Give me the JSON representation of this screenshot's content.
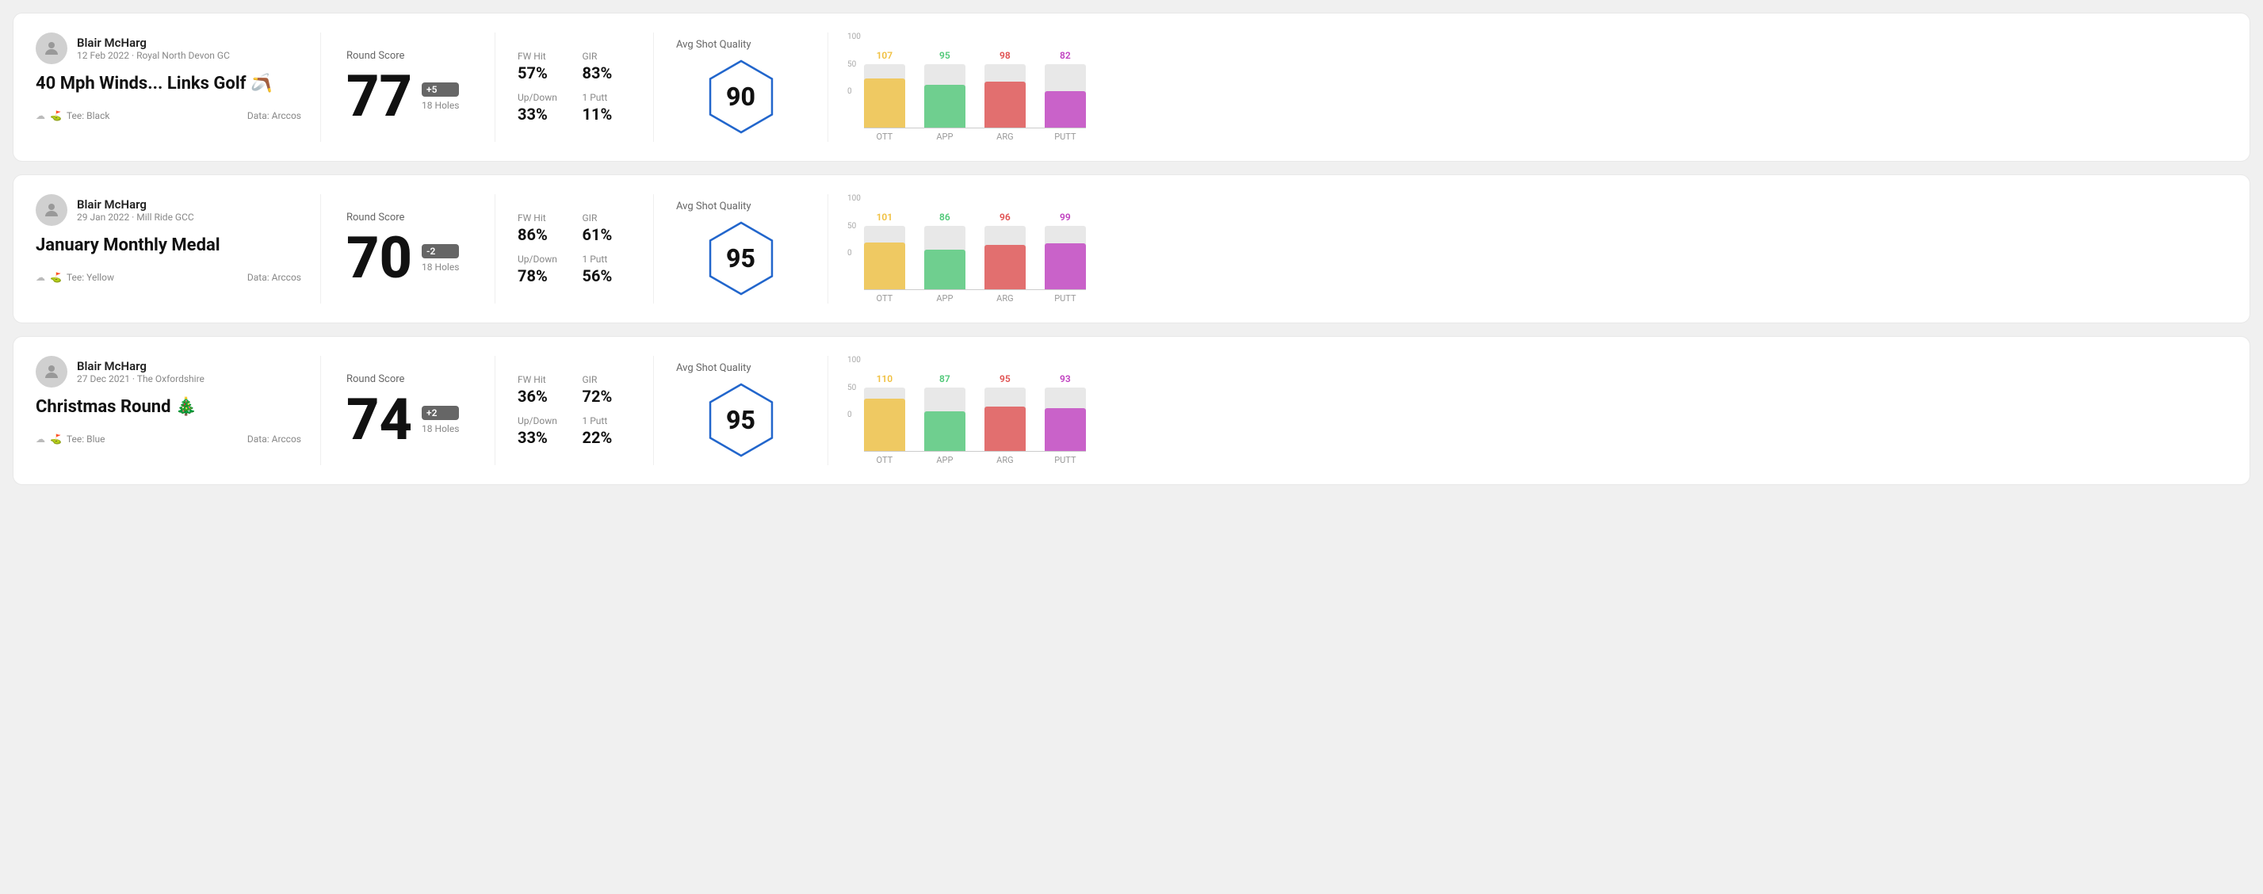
{
  "rounds": [
    {
      "id": "round-1",
      "user": {
        "name": "Blair McHarg",
        "meta": "12 Feb 2022 · Royal North Devon GC"
      },
      "title": "40 Mph Winds... Links Golf 🪃",
      "tee": "Black",
      "dataSource": "Data: Arccos",
      "roundScore": {
        "label": "Round Score",
        "score": "77",
        "badge": "+5",
        "badgeType": "positive",
        "holes": "18 Holes"
      },
      "stats": {
        "fwHit": {
          "label": "FW Hit",
          "value": "57%"
        },
        "gir": {
          "label": "GIR",
          "value": "83%"
        },
        "upDown": {
          "label": "Up/Down",
          "value": "33%"
        },
        "onePutt": {
          "label": "1 Putt",
          "value": "11%"
        }
      },
      "avgShotQuality": {
        "label": "Avg Shot Quality",
        "score": "90"
      },
      "chart": {
        "columns": [
          {
            "label": "OTT",
            "value": 107,
            "color": "#f0c040",
            "heightPct": 78
          },
          {
            "label": "APP",
            "value": 95,
            "color": "#50c878",
            "heightPct": 68
          },
          {
            "label": "ARG",
            "value": 98,
            "color": "#e05050",
            "heightPct": 72
          },
          {
            "label": "PUTT",
            "value": 82,
            "color": "#c040c0",
            "heightPct": 58
          }
        ],
        "yLabels": [
          "100",
          "50",
          "0"
        ]
      }
    },
    {
      "id": "round-2",
      "user": {
        "name": "Blair McHarg",
        "meta": "29 Jan 2022 · Mill Ride GCC"
      },
      "title": "January Monthly Medal",
      "tee": "Yellow",
      "dataSource": "Data: Arccos",
      "roundScore": {
        "label": "Round Score",
        "score": "70",
        "badge": "-2",
        "badgeType": "negative",
        "holes": "18 Holes"
      },
      "stats": {
        "fwHit": {
          "label": "FW Hit",
          "value": "86%"
        },
        "gir": {
          "label": "GIR",
          "value": "61%"
        },
        "upDown": {
          "label": "Up/Down",
          "value": "78%"
        },
        "onePutt": {
          "label": "1 Putt",
          "value": "56%"
        }
      },
      "avgShotQuality": {
        "label": "Avg Shot Quality",
        "score": "95"
      },
      "chart": {
        "columns": [
          {
            "label": "OTT",
            "value": 101,
            "color": "#f0c040",
            "heightPct": 74
          },
          {
            "label": "APP",
            "value": 86,
            "color": "#50c878",
            "heightPct": 62
          },
          {
            "label": "ARG",
            "value": 96,
            "color": "#e05050",
            "heightPct": 70
          },
          {
            "label": "PUTT",
            "value": 99,
            "color": "#c040c0",
            "heightPct": 73
          }
        ],
        "yLabels": [
          "100",
          "50",
          "0"
        ]
      }
    },
    {
      "id": "round-3",
      "user": {
        "name": "Blair McHarg",
        "meta": "27 Dec 2021 · The Oxfordshire"
      },
      "title": "Christmas Round 🎄",
      "tee": "Blue",
      "dataSource": "Data: Arccos",
      "roundScore": {
        "label": "Round Score",
        "score": "74",
        "badge": "+2",
        "badgeType": "positive",
        "holes": "18 Holes"
      },
      "stats": {
        "fwHit": {
          "label": "FW Hit",
          "value": "36%"
        },
        "gir": {
          "label": "GIR",
          "value": "72%"
        },
        "upDown": {
          "label": "Up/Down",
          "value": "33%"
        },
        "onePutt": {
          "label": "1 Putt",
          "value": "22%"
        }
      },
      "avgShotQuality": {
        "label": "Avg Shot Quality",
        "score": "95"
      },
      "chart": {
        "columns": [
          {
            "label": "OTT",
            "value": 110,
            "color": "#f0c040",
            "heightPct": 82
          },
          {
            "label": "APP",
            "value": 87,
            "color": "#50c878",
            "heightPct": 63
          },
          {
            "label": "ARG",
            "value": 95,
            "color": "#e05050",
            "heightPct": 70
          },
          {
            "label": "PUTT",
            "value": 93,
            "color": "#c040c0",
            "heightPct": 68
          }
        ],
        "yLabels": [
          "100",
          "50",
          "0"
        ]
      }
    }
  ],
  "labels": {
    "teePrefix": "Tee:",
    "weather": "☁",
    "teeIcon": "⛳"
  }
}
